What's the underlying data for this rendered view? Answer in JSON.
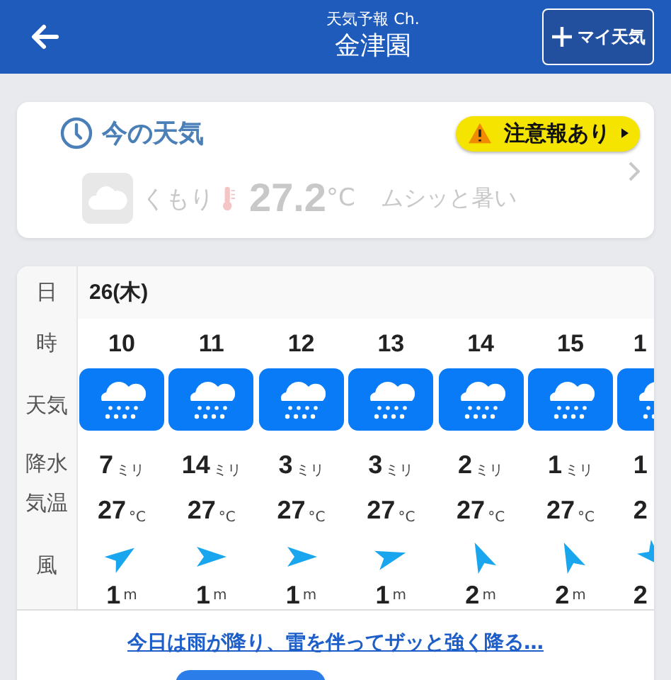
{
  "header": {
    "subtitle": "天気予報 Ch.",
    "title": "金津園",
    "my_weather_button": "マイ天気"
  },
  "current": {
    "heading": "今の天気",
    "alert": "注意報あり",
    "icon": {
      "kind": "cloudy"
    },
    "condition": "くもり",
    "temperature": "27.2",
    "temp_unit": "°C",
    "comment": "ムシッと暑い"
  },
  "hourly": {
    "row_labels": [
      "日",
      "時",
      "天気",
      "降水",
      "気温",
      "風"
    ],
    "date": "26(木)",
    "hours": [
      {
        "hour": "10",
        "icon": {
          "kind": "rain"
        },
        "precip": "7",
        "precip_unit": "ミリ",
        "temp": "27",
        "temp_unit": "°C",
        "wind_arrow": {
          "kind": "NE"
        },
        "wind": "1",
        "wind_unit": "m"
      },
      {
        "hour": "11",
        "icon": {
          "kind": "rain"
        },
        "precip": "14",
        "precip_unit": "ミリ",
        "temp": "27",
        "temp_unit": "°C",
        "wind_arrow": {
          "kind": "E"
        },
        "wind": "1",
        "wind_unit": "m"
      },
      {
        "hour": "12",
        "icon": {
          "kind": "rain"
        },
        "precip": "3",
        "precip_unit": "ミリ",
        "temp": "27",
        "temp_unit": "°C",
        "wind_arrow": {
          "kind": "E"
        },
        "wind": "1",
        "wind_unit": "m"
      },
      {
        "hour": "13",
        "icon": {
          "kind": "rain"
        },
        "precip": "3",
        "precip_unit": "ミリ",
        "temp": "27",
        "temp_unit": "°C",
        "wind_arrow": {
          "kind": "ENE"
        },
        "wind": "1",
        "wind_unit": "m"
      },
      {
        "hour": "14",
        "icon": {
          "kind": "rain"
        },
        "precip": "2",
        "precip_unit": "ミリ",
        "temp": "27",
        "temp_unit": "°C",
        "wind_arrow": {
          "kind": "NNW"
        },
        "wind": "2",
        "wind_unit": "m"
      },
      {
        "hour": "15",
        "icon": {
          "kind": "rain"
        },
        "precip": "1",
        "precip_unit": "ミリ",
        "temp": "27",
        "temp_unit": "°C",
        "wind_arrow": {
          "kind": "NNW"
        },
        "wind": "2",
        "wind_unit": "m"
      },
      {
        "hour": "1",
        "icon": {
          "kind": "rain"
        },
        "precip": "1",
        "temp": "2",
        "wind_arrow": {
          "kind": "SE"
        },
        "wind": "2"
      }
    ],
    "summary_link": "今日は雨が降り、雷を伴ってザッと強く降る…"
  }
}
